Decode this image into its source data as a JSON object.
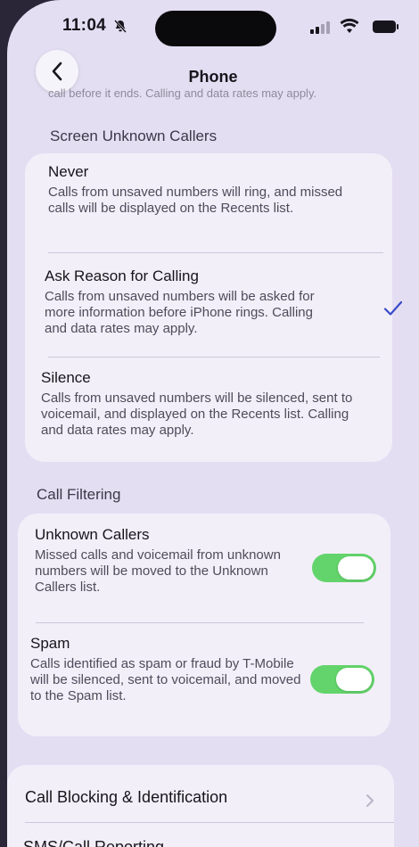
{
  "status_bar": {
    "time": "11:04",
    "bell_icon": "bell-slash-icon"
  },
  "nav": {
    "title": "Phone",
    "back_icon": "chevron-left-icon"
  },
  "faded_top_text": "call before it ends. Calling and data rates may apply.",
  "screen_unknown": {
    "header": "Screen Unknown Callers",
    "options": [
      {
        "title": "Never",
        "desc": "Calls from unsaved numbers will ring, and missed calls will be displayed on the Recents list.",
        "selected": false
      },
      {
        "title": "Ask Reason for Calling",
        "desc": "Calls from unsaved numbers will be asked for more information before iPhone rings. Calling and data rates may apply.",
        "selected": true
      },
      {
        "title": "Silence",
        "desc": "Calls from unsaved numbers will be silenced, sent to voicemail, and displayed on the Recents list. Calling and data rates may apply.",
        "selected": false
      }
    ]
  },
  "call_filtering": {
    "header": "Call Filtering",
    "items": [
      {
        "title": "Unknown Callers",
        "desc": "Missed calls and voicemail from unknown numbers will be moved to the Unknown Callers list.",
        "enabled": true
      },
      {
        "title": "Spam",
        "desc": "Calls identified as spam or fraud by T-Mobile will be silenced, sent to voicemail, and moved to the Spam list.",
        "enabled": true
      }
    ]
  },
  "bottom": {
    "call_blocking": "Call Blocking & Identification",
    "partial_next": "SMS/Call Reporting"
  },
  "colors": {
    "toggle_on": "#63d46b",
    "accent": "#3a4ac6",
    "background": "#e4def3"
  }
}
